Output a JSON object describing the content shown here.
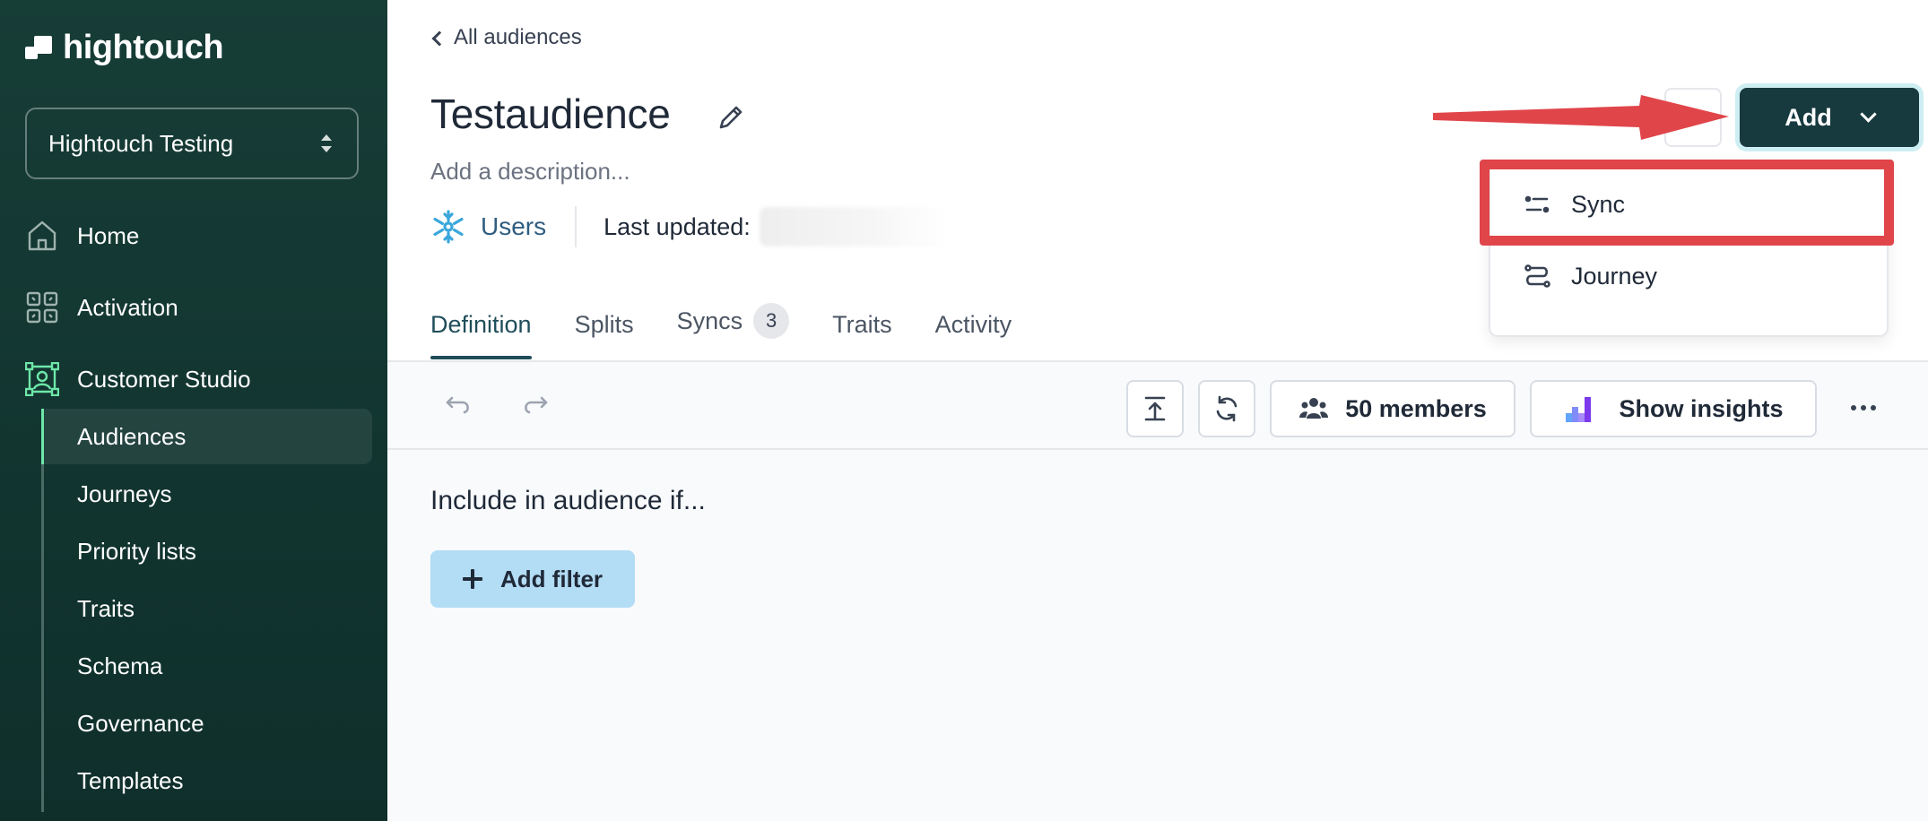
{
  "brand": {
    "name": "hightouch"
  },
  "workspace": {
    "name": "Hightouch Testing"
  },
  "nav": {
    "items": [
      {
        "label": "Home",
        "icon": "home-icon"
      },
      {
        "label": "Activation",
        "icon": "activation-icon"
      },
      {
        "label": "Customer Studio",
        "icon": "customer-studio-icon"
      }
    ],
    "customer_studio_items": [
      {
        "label": "Audiences",
        "active": true
      },
      {
        "label": "Journeys"
      },
      {
        "label": "Priority lists"
      },
      {
        "label": "Traits"
      },
      {
        "label": "Schema"
      },
      {
        "label": "Governance"
      },
      {
        "label": "Templates"
      }
    ]
  },
  "header": {
    "back_label": "All audiences",
    "title": "Testaudience",
    "description_placeholder": "Add a description...",
    "model_label": "Users",
    "model_icon": "snowflake-icon",
    "last_updated_label": "Last updated:"
  },
  "tabs": [
    {
      "label": "Definition",
      "active": true
    },
    {
      "label": "Splits"
    },
    {
      "label": "Syncs",
      "badge": "3"
    },
    {
      "label": "Traits"
    },
    {
      "label": "Activity"
    }
  ],
  "toolbar": {
    "members_label": "50 members",
    "insights_label": "Show insights"
  },
  "content": {
    "include_label": "Include in audience if...",
    "add_filter_label": "Add filter"
  },
  "add_menu": {
    "button_label": "Add",
    "items": [
      {
        "label": "Sync",
        "icon": "sync-icon"
      },
      {
        "label": "Journey",
        "icon": "journey-icon"
      }
    ]
  },
  "colors": {
    "sidebar_bg": "#173d37",
    "accent": "#173a3f",
    "active_indicator": "#6ee7a8",
    "link": "#2f5d80",
    "filter_button": "#b3dcf5",
    "annotation": "#e0454a"
  }
}
